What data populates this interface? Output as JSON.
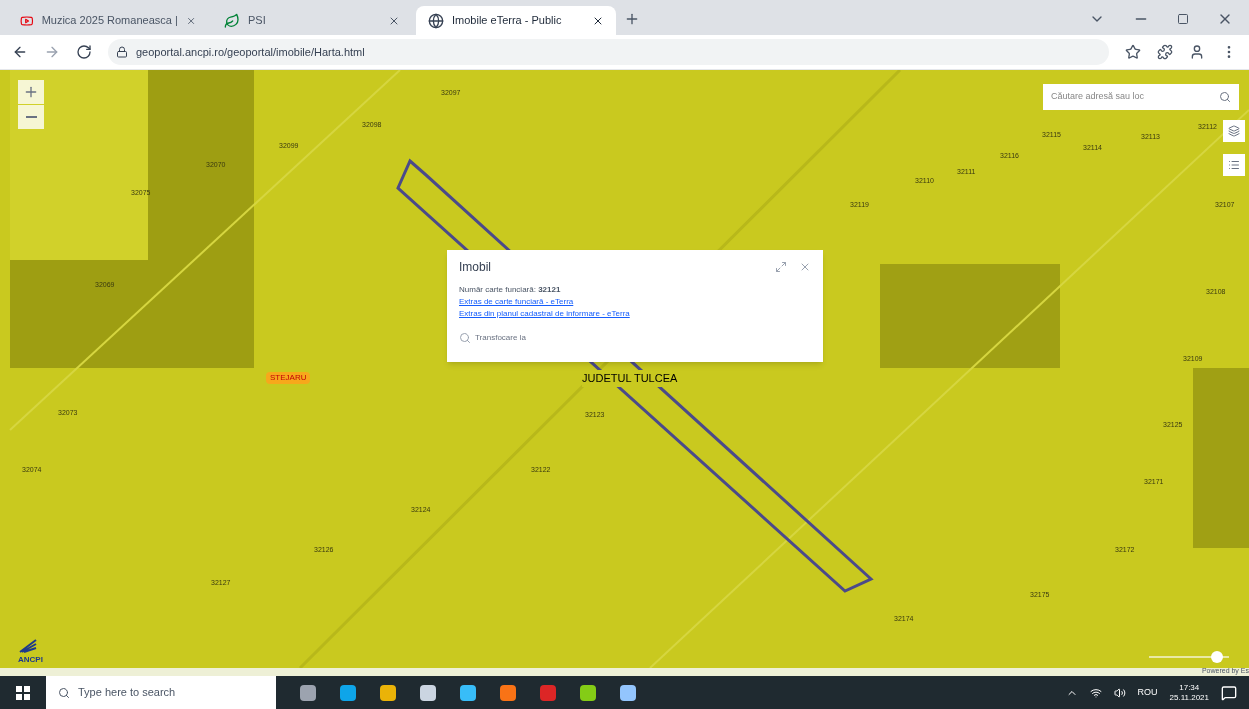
{
  "browser": {
    "tabs": [
      {
        "title": "Muzica 2025 Romaneasca |",
        "selected": false,
        "kind": "video"
      },
      {
        "title": "PSI",
        "selected": false,
        "kind": "site"
      },
      {
        "title": "Imobile eTerra - Public",
        "selected": true,
        "kind": "globe"
      }
    ],
    "url": "geoportal.ancpi.ro/geoportal/imobile/Harta.html"
  },
  "map": {
    "search": {
      "placeholder": "Căutare adresă sau loc"
    },
    "parcel_labels": [
      "32097",
      "32098",
      "32099",
      "32070",
      "32075",
      "32069",
      "32112",
      "32113",
      "32114",
      "32115",
      "32116",
      "32111",
      "32110",
      "32119",
      "32107",
      "32108",
      "32109",
      "32123",
      "32122",
      "32124",
      "32125",
      "32126",
      "32127",
      "32073",
      "32074",
      "32171",
      "32172",
      "32175",
      "32174"
    ],
    "place_label": "STEJARU",
    "county_label": "JUDETUL TULCEA",
    "popup": {
      "title": "Imobil",
      "info": "Număr carte funciară: **32121**",
      "links": [
        "Extras de carte funciară - eTerra",
        "Extras din planul cadastral de informare - eTerra"
      ],
      "action": "Transfocare la"
    },
    "logo": "ANCPI",
    "attribution": "Powered by Es",
    "scale": {
      "level": 0.85
    }
  },
  "taskbar": {
    "search_placeholder": "Type here to search",
    "language": "ROU",
    "time": "17:34",
    "date": "25.11.2021"
  }
}
